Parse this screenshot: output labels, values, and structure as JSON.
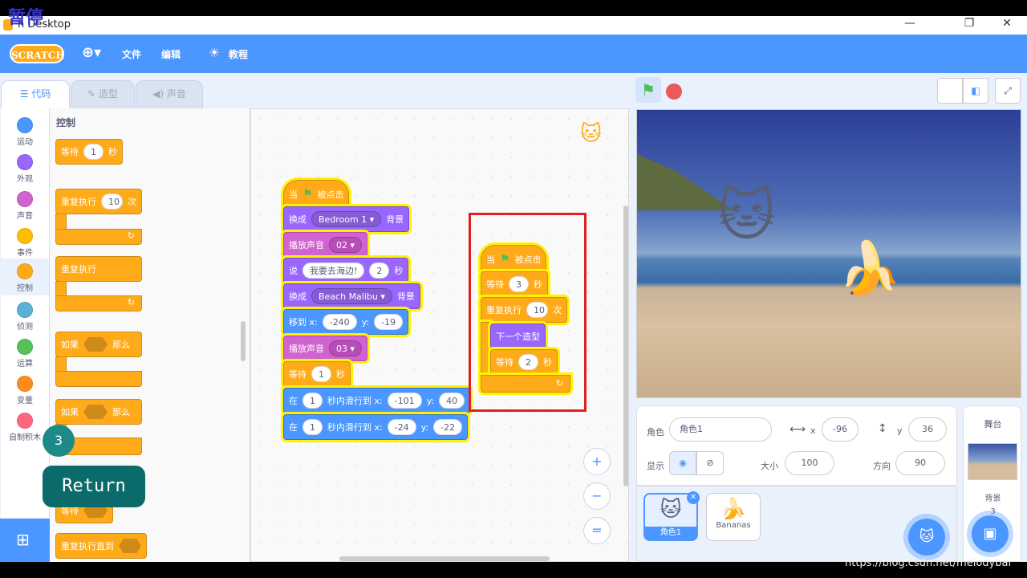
{
  "overlay": {
    "pause_label": "暂停",
    "badge_number": "3",
    "return_label": "Return",
    "watermark": "https://blog.csdn.net/melodybai"
  },
  "window": {
    "title": "h Desktop",
    "minimize": "—",
    "restore": "❐",
    "close": "✕"
  },
  "menu": {
    "logo": "SCRATCH",
    "language_icon": "globe-icon",
    "file": "文件",
    "edit": "编辑",
    "tutorials": "教程"
  },
  "tabs": {
    "code": "代码",
    "costumes": "造型",
    "sounds": "声音"
  },
  "categories": [
    {
      "label": "运动",
      "color": "#4c97ff"
    },
    {
      "label": "外观",
      "color": "#9966ff"
    },
    {
      "label": "声音",
      "color": "#cf63cf"
    },
    {
      "label": "事件",
      "color": "#ffbf00"
    },
    {
      "label": "控制",
      "color": "#ffab19"
    },
    {
      "label": "侦测",
      "color": "#5cb1d6"
    },
    {
      "label": "运算",
      "color": "#59c059"
    },
    {
      "label": "变量",
      "color": "#ff8c1a"
    },
    {
      "label": "自制积木",
      "color": "#ff6680"
    }
  ],
  "palette": {
    "heading": "控制",
    "wait": "等待",
    "wait_val": "1",
    "seconds": "秒",
    "repeat": "重复执行",
    "repeat_val": "10",
    "times": "次",
    "forever": "重复执行",
    "if": "如果",
    "then": "那么",
    "wait_until": "等待",
    "repeat_until": "重复执行直到"
  },
  "script1": {
    "when": "当",
    "clicked": "被点击",
    "switch_bg": "换成",
    "bg1": "Bedroom 1",
    "bg": "背景",
    "play": "播放声音",
    "snd1": "02",
    "say": "说",
    "say_text": "我要去海边!",
    "say_secs": "2",
    "secs": "秒",
    "bg2": "Beach Malibu",
    "goto": "移到 x:",
    "gx": "-240",
    "y": "y:",
    "gy": "-19",
    "snd2": "03",
    "wait": "等待",
    "wait_val": "1",
    "glide_pre": "在",
    "glide1_t": "1",
    "glide_mid": "秒内滑行到 x:",
    "g1x": "-101",
    "g1y": "40",
    "glide2_t": "1",
    "g2x": "-24",
    "g2y": "-22"
  },
  "script2": {
    "when": "当",
    "clicked": "被点击",
    "wait": "等待",
    "wait_val": "3",
    "secs": "秒",
    "repeat": "重复执行",
    "repeat_val": "10",
    "times": "次",
    "next_costume": "下一个造型",
    "wait2_val": "2"
  },
  "zoom": {
    "in": "+",
    "out": "−",
    "reset": "="
  },
  "sprite_info": {
    "sprite_label": "角色",
    "sprite_name": "角色1",
    "x_label": "x",
    "x_val": "-96",
    "y_label": "y",
    "y_val": "36",
    "show_label": "显示",
    "size_label": "大小",
    "size_val": "100",
    "dir_label": "方向",
    "dir_val": "90"
  },
  "sprites": [
    {
      "name": "角色1"
    },
    {
      "name": "Bananas"
    }
  ],
  "stage_panel": {
    "title": "舞台",
    "backdrops_label": "背景",
    "backdrops_count": "3"
  }
}
